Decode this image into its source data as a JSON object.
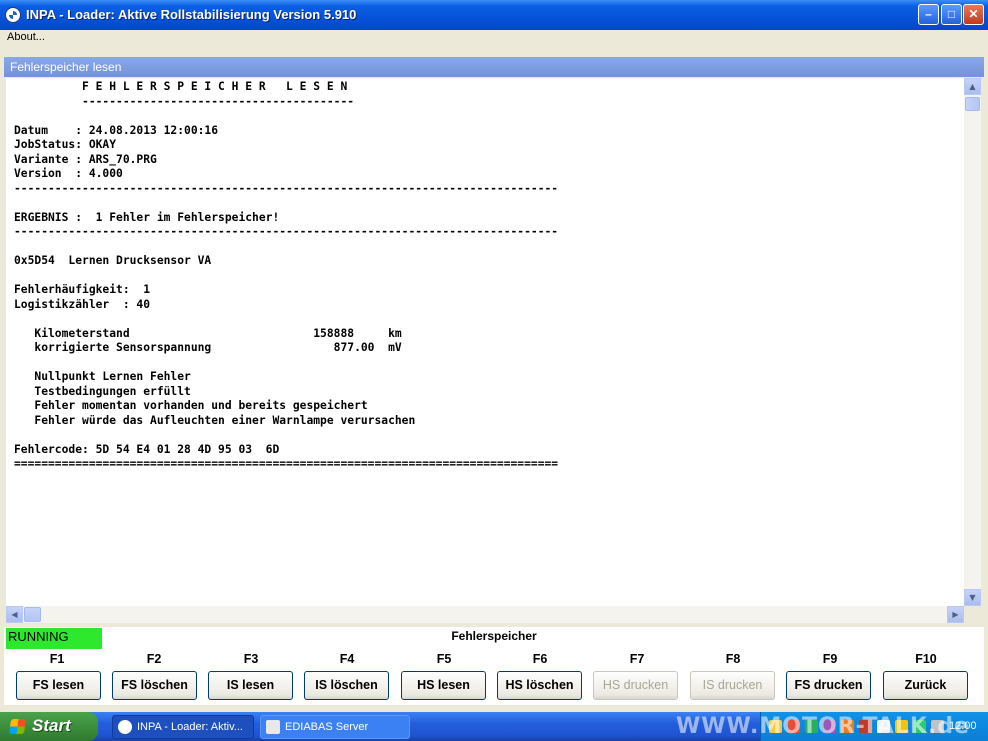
{
  "window": {
    "title": "INPA - Loader:  Aktive Rollstabilisierung Version 5.910",
    "controls": {
      "minimize": "–",
      "maximize": "□",
      "close": "✕"
    }
  },
  "menu": {
    "about": "About..."
  },
  "panel": {
    "title": "Fehlerspeicher lesen"
  },
  "output": {
    "text": "          F E H L E R S P E I C H E R   L E S E N\n          ----------------------------------------\n\nDatum    : 24.08.2013 12:00:16\nJobStatus: OKAY\nVariante : ARS_70.PRG\nVersion  : 4.000\n--------------------------------------------------------------------------------\n\nERGEBNIS :  1 Fehler im Fehlerspeicher!\n--------------------------------------------------------------------------------\n\n0x5D54  Lernen Drucksensor VA\n\nFehlerhäufigkeit:  1\nLogistikzähler  : 40\n\n   Kilometerstand                           158888     km\n   korrigierte Sensorspannung                  877.00  mV\n\n   Nullpunkt Lernen Fehler\n   Testbedingungen erfüllt\n   Fehler momentan vorhanden und bereits gespeichert\n   Fehler würde das Aufleuchten einer Warnlampe verursachen\n\nFehlercode: 5D 54 E4 01 28 4D 95 03  6D\n================================================================================"
  },
  "status": {
    "running": "RUNNING",
    "section": "Fehlerspeicher",
    "running_color": "#2ee82e"
  },
  "fkeys": [
    {
      "key": "F1",
      "label": "FS lesen",
      "enabled": true
    },
    {
      "key": "F2",
      "label": "FS löschen",
      "enabled": true
    },
    {
      "key": "F3",
      "label": "IS lesen",
      "enabled": true
    },
    {
      "key": "F4",
      "label": "IS löschen",
      "enabled": true
    },
    {
      "key": "F5",
      "label": "HS lesen",
      "enabled": true
    },
    {
      "key": "F6",
      "label": "HS löschen",
      "enabled": true
    },
    {
      "key": "F7",
      "label": "HS drucken",
      "enabled": false
    },
    {
      "key": "F8",
      "label": "IS drucken",
      "enabled": false
    },
    {
      "key": "F9",
      "label": "FS drucken",
      "enabled": true
    },
    {
      "key": "F10",
      "label": "Zurück",
      "enabled": true
    }
  ],
  "taskbar": {
    "start": "Start",
    "tasks": [
      "INPA - Loader: Aktiv...",
      "EDIABAS Server"
    ],
    "watermark": "WWW.MOTOR-TALK.de",
    "clock": "12:00"
  },
  "icons": {
    "app": "bmw-logo-icon",
    "start": "windows-flag-icon",
    "ediabas": "ediabas-icon",
    "tray": [
      "tray-icon",
      "tray-icon",
      "tray-icon",
      "tray-icon",
      "tray-icon",
      "tray-icon",
      "tray-icon",
      "tray-icon",
      "tray-icon",
      "tray-icon"
    ]
  }
}
